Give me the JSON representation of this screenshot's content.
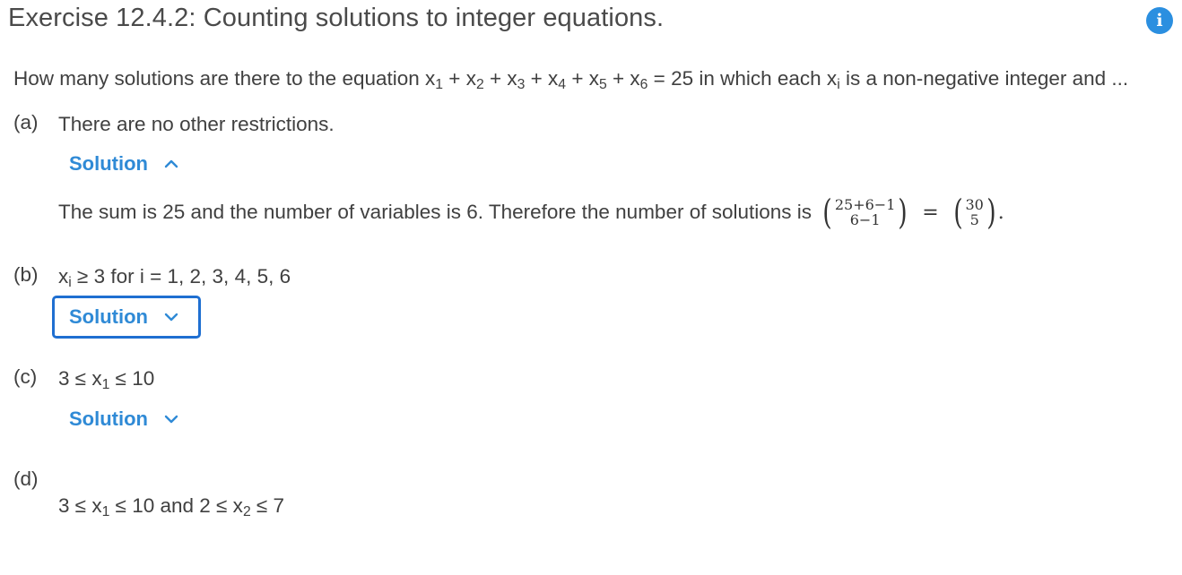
{
  "header": {
    "title": "Exercise 12.4.2: Counting solutions to integer equations.",
    "info_icon": "info-icon"
  },
  "intro": {
    "prefix": "How many solutions are there to the equation x",
    "eq_sum": "25",
    "suffix": " in which each x",
    "suffix2": " is a non-negative integer and ..."
  },
  "parts": {
    "a": {
      "label": "(a)",
      "text": "There are no other restrictions.",
      "solution_label": "Solution",
      "solution_expanded": true,
      "solution_text": "The sum is 25 and the number of variables is 6. Therefore the number of solutions is",
      "binom1_top": "25+6−1",
      "binom1_bottom": "6−1",
      "binom2_top": "30",
      "binom2_bottom": "5"
    },
    "b": {
      "label": "(b)",
      "text_suffix": " ≥ 3 for i = 1, 2, 3, 4, 5, 6",
      "solution_label": "Solution",
      "solution_expanded": false
    },
    "c": {
      "label": "(c)",
      "text_prefix": "3 ≤ x",
      "text_suffix": " ≤ 10",
      "solution_label": "Solution",
      "solution_expanded": false
    },
    "d": {
      "label": "(d)",
      "text_prefix": "3 ≤ x",
      "text_mid": " ≤ 10 and 2 ≤ x",
      "text_suffix": " ≤ 7"
    }
  },
  "colors": {
    "accent": "#2f8ad6",
    "info_icon_bg": "#2b8fe0",
    "focus_border": "#1f6fd1",
    "text": "#404040"
  }
}
